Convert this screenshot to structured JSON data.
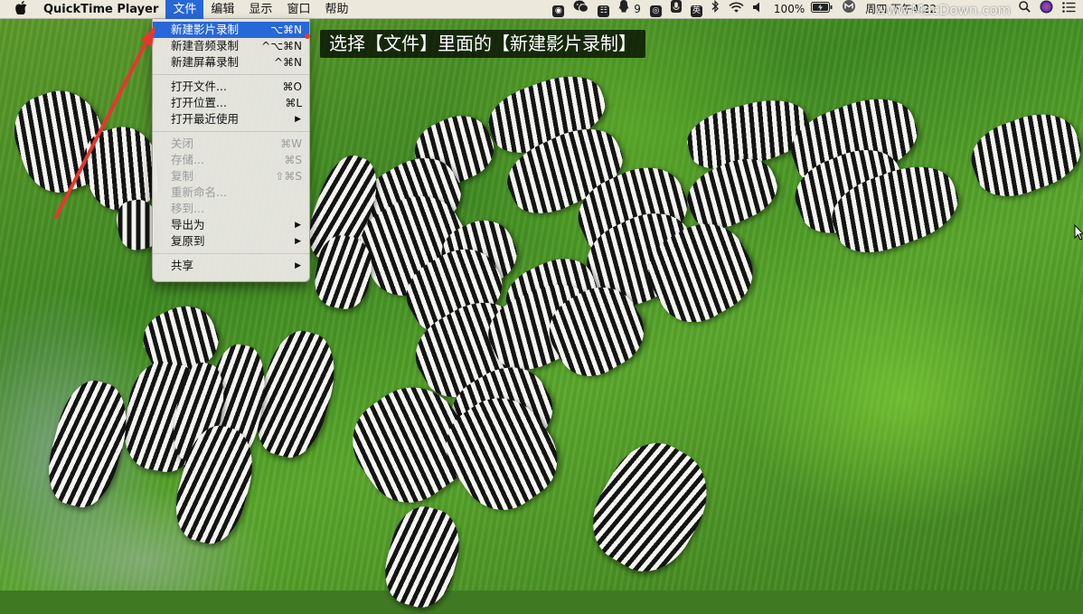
{
  "menubar": {
    "apple": "",
    "app_name": "QuickTime Player",
    "menus": [
      {
        "label": "文件",
        "active": true
      },
      {
        "label": "编辑"
      },
      {
        "label": "显示"
      },
      {
        "label": "窗口"
      },
      {
        "label": "帮助"
      }
    ],
    "status": {
      "badge_count": "9",
      "ying": "英",
      "battery": "100%",
      "datetime": "周四 下午4:22",
      "watermark": "www.MacDown.com"
    }
  },
  "file_menu": {
    "items": [
      {
        "label": "新建影片录制",
        "shortcut": "⌥⌘N",
        "highlighted": true
      },
      {
        "label": "新建音频录制",
        "shortcut": "^⌥⌘N"
      },
      {
        "label": "新建屏幕录制",
        "shortcut": "^⌘N"
      },
      {
        "label": "打开文件...",
        "shortcut": "⌘O"
      },
      {
        "label": "打开位置...",
        "shortcut": "⌘L"
      },
      {
        "label": "打开最近使用",
        "submenu": true
      },
      {
        "label": "关闭",
        "shortcut": "⌘W",
        "disabled": true
      },
      {
        "label": "存储...",
        "shortcut": "⌘S",
        "disabled": true
      },
      {
        "label": "复制",
        "shortcut": "⇧⌘S",
        "disabled": true
      },
      {
        "label": "重新命名...",
        "disabled": true
      },
      {
        "label": "移到...",
        "disabled": true
      },
      {
        "label": "导出为",
        "submenu": true
      },
      {
        "label": "复原到",
        "submenu": true
      },
      {
        "label": "共享",
        "submenu": true
      }
    ]
  },
  "annotation": {
    "text": "选择【文件】里面的【新建影片录制】"
  },
  "colors": {
    "highlight": "#2867d8",
    "arrow": "#e8362f"
  }
}
